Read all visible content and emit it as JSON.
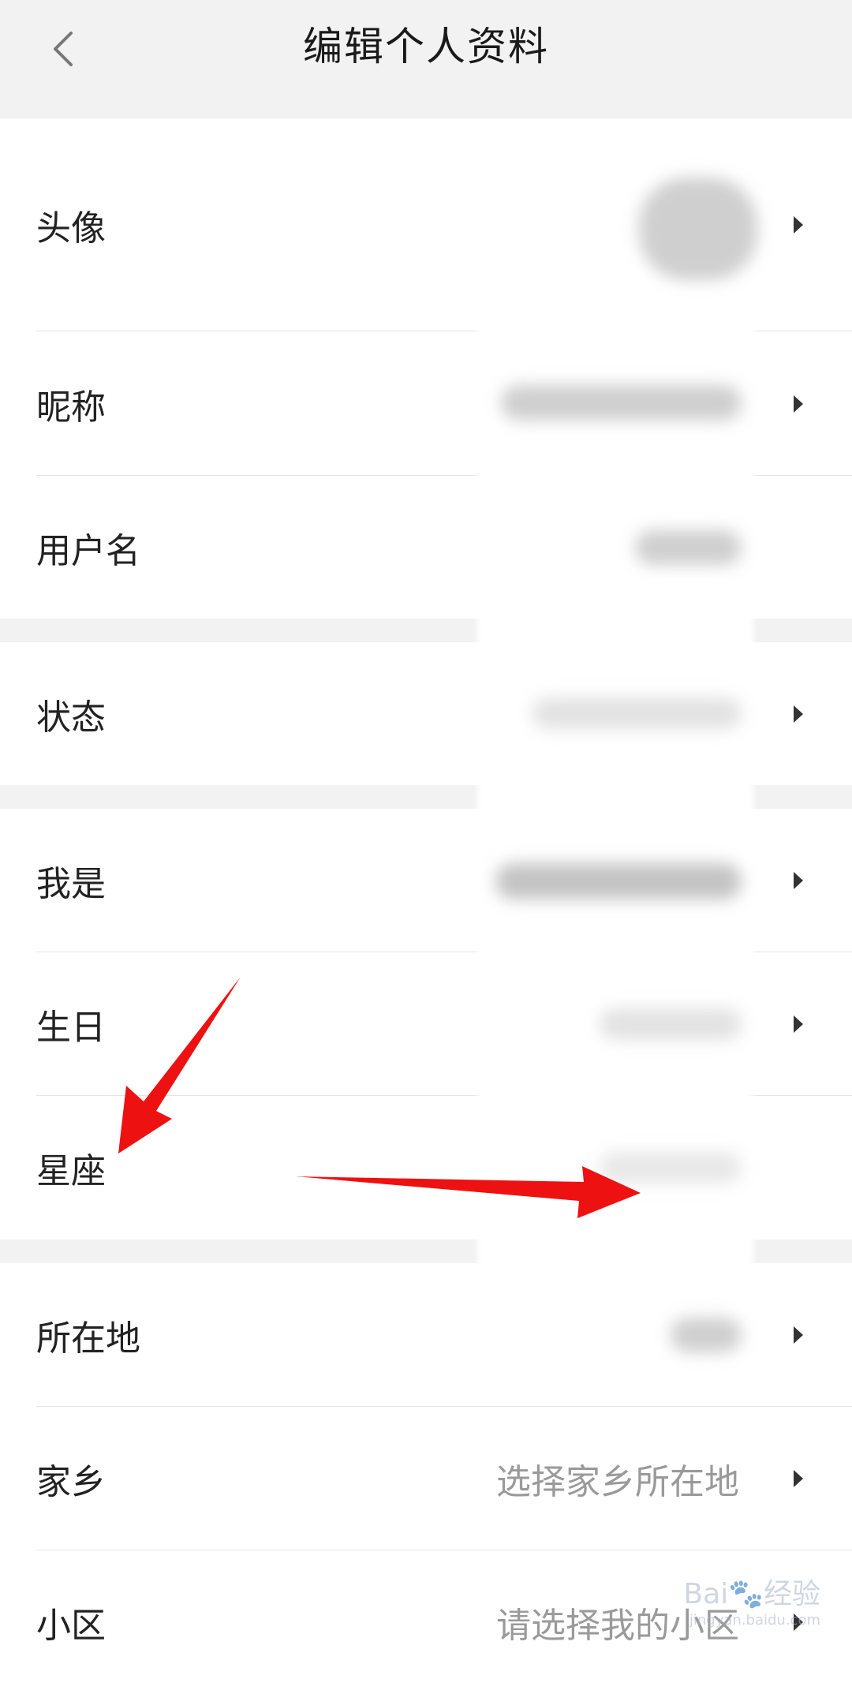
{
  "header": {
    "title": "编辑个人资料",
    "back_icon": "chevron-left-icon"
  },
  "rows": [
    {
      "label": "头像",
      "value": "",
      "has_arrow": true
    },
    {
      "label": "昵称",
      "value": "",
      "has_arrow": true
    },
    {
      "label": "用户名",
      "value": "",
      "has_arrow": false
    },
    {
      "label": "状态",
      "value": "",
      "has_arrow": true
    },
    {
      "label": "我是",
      "value": "",
      "has_arrow": true
    },
    {
      "label": "生日",
      "value": "",
      "has_arrow": true
    },
    {
      "label": "星座",
      "value": "",
      "has_arrow": false
    },
    {
      "label": "所在地",
      "value": "",
      "has_arrow": true
    },
    {
      "label": "家乡",
      "value": "选择家乡所在地",
      "has_arrow": true
    },
    {
      "label": "小区",
      "value": "请选择我的小区",
      "has_arrow": true
    }
  ],
  "watermark": {
    "brand": "Bai",
    "suffix": "经验",
    "url": "jingyan.baidu.com"
  },
  "colors": {
    "background": "#f2f2f2",
    "row_bg": "#ffffff",
    "value_text": "#9a9a9a",
    "annotation_arrow": "#ee1111"
  }
}
